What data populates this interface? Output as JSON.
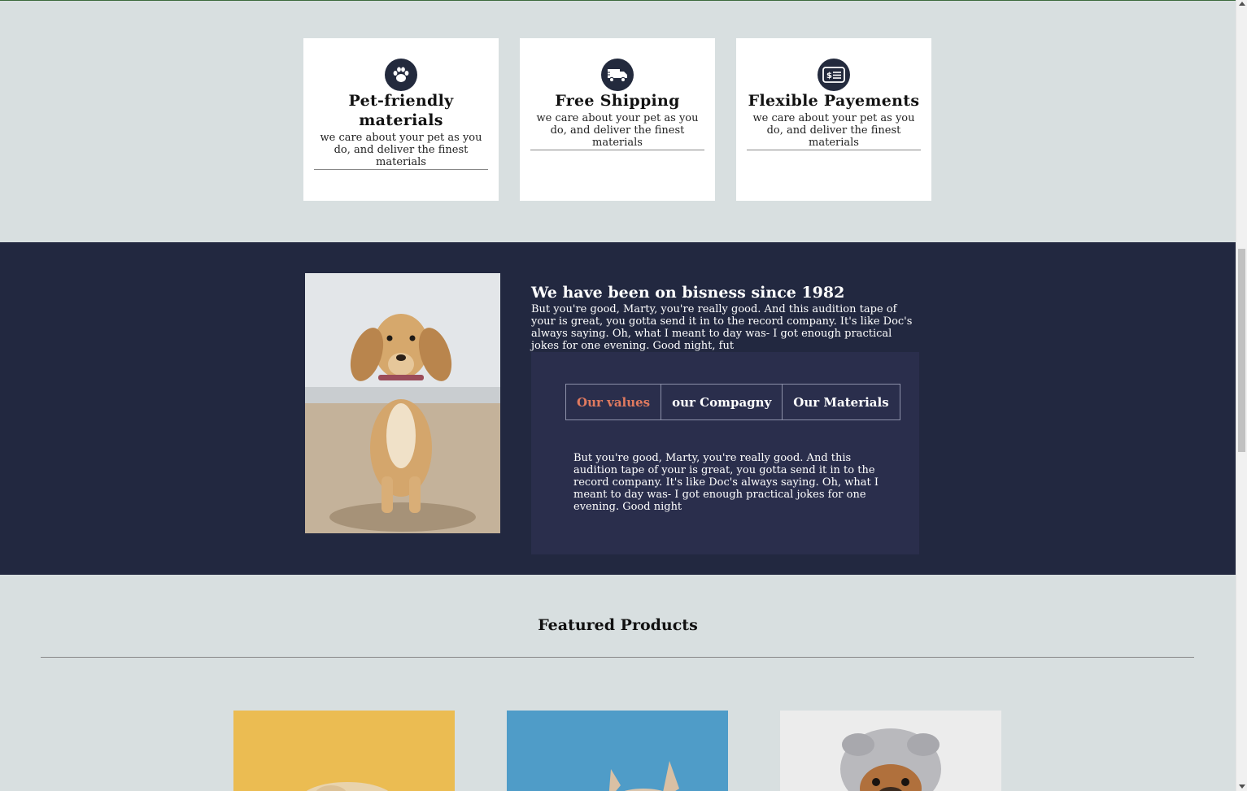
{
  "features": [
    {
      "icon": "paw-icon",
      "title": "Pet-friendly materials",
      "desc": "we care about your pet as you do, and deliver the finest materials"
    },
    {
      "icon": "truck-icon",
      "title": "Free Shipping",
      "desc": "we care about your pet as you do, and deliver the finest materials"
    },
    {
      "icon": "payment-card-icon",
      "title": "Flexible Payements",
      "desc": "we care about your pet as you do, and deliver the finest materials"
    }
  ],
  "about": {
    "title": "We have been on bisness since 1982",
    "text": "But you're good, Marty, you're really good. And this audition tape of your is great, you gotta send it in to the record company. It's like Doc's always saying. Oh, what I meant to day was- I got enough practical jokes for one evening. Good night, fut",
    "tabs": [
      {
        "label": "Our values",
        "active": true
      },
      {
        "label": "our Compagny",
        "active": false
      },
      {
        "label": "Our Materials",
        "active": false
      }
    ],
    "tab_content": "But you're good, Marty, you're really good. And this audition tape of your is great, you gotta send it in to the record company. It's like Doc's always saying. Oh, what I meant to day was- I got enough practical jokes for one evening. Good night"
  },
  "featured": {
    "title": "Featured Products"
  },
  "colors": {
    "page_bg": "#d8dfe0",
    "dark_bg": "#222840",
    "tabs_bg": "#2a2e4c",
    "accent": "#e07a5f",
    "icon_bg": "#232a3d"
  }
}
